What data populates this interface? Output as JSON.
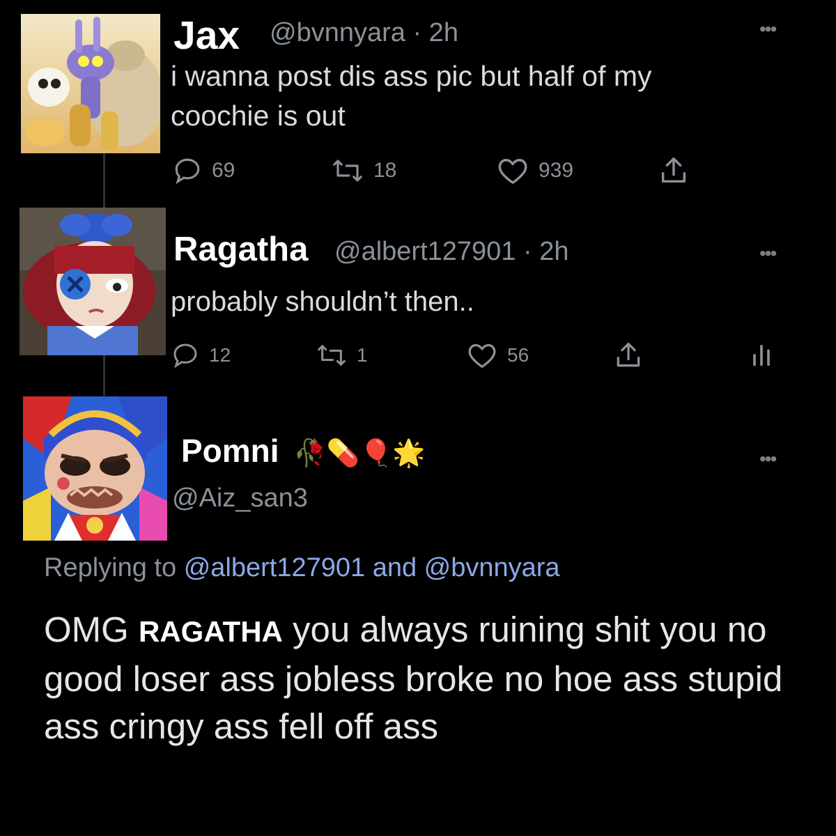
{
  "tweets": [
    {
      "name": "Jax",
      "handle": "@bvnnyara",
      "time": "· 2h",
      "text_line1": "i wanna post dis ass pic but half of my",
      "text_line2": "coochie is out",
      "replies": "69",
      "retweets": "18",
      "likes": "939"
    },
    {
      "name": "Ragatha",
      "handle": "@albert127901",
      "time": "· 2h",
      "text": "probably shouldn’t then..",
      "replies": "12",
      "retweets": "1",
      "likes": "56"
    },
    {
      "name": "Pomni",
      "emoji": "🥀💊🎈🌟",
      "handle": "@Aiz_san3",
      "replying_label": "Replying to",
      "replying_mention1": "@albert127901",
      "replying_and": "and",
      "replying_mention2": "@bvnnyara",
      "text_prefix": "OMG ",
      "text_caps": "RAGATHA",
      "text_rest": " you always ruining shit you no good loser ass jobless broke no hoe ass stupid ass cringy ass fell off ass"
    }
  ],
  "colors": {
    "background": "#000000",
    "secondary_text": "#8b9198",
    "mention": "#8aa9e6",
    "thread_line": "#2f3336"
  },
  "icons": [
    "reply-icon",
    "retweet-icon",
    "like-icon",
    "share-icon",
    "analytics-icon",
    "more-icon"
  ]
}
